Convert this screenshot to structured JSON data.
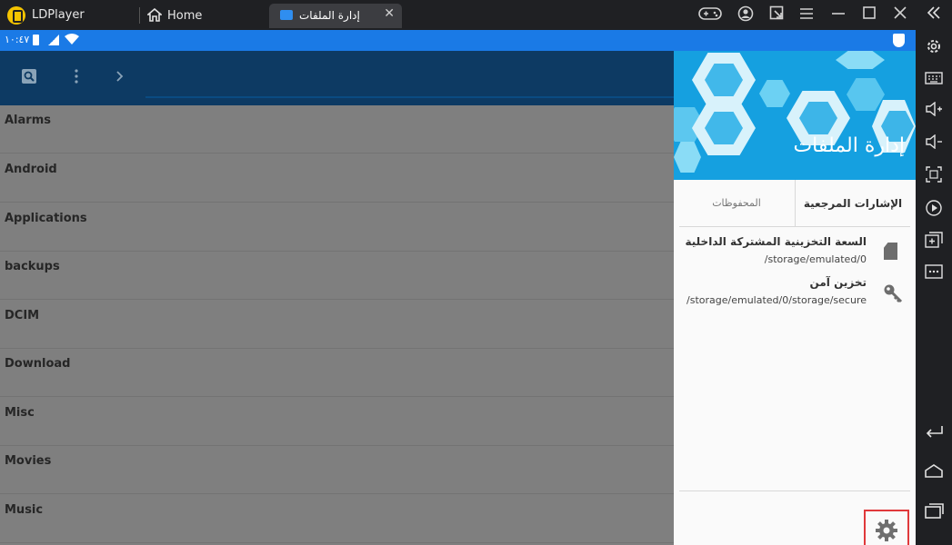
{
  "titlebar": {
    "app_name": "LDPlayer",
    "tabs": [
      {
        "label": "Home",
        "icon": "home-icon"
      },
      {
        "label": "إدارة الملفات",
        "icon": "folder-icon",
        "close": "✕"
      }
    ],
    "controls": [
      "gamepad-icon",
      "account-icon",
      "share-icon",
      "menu-icon",
      "minimize-icon",
      "maximize-icon",
      "close-icon"
    ]
  },
  "status_bar": {
    "time": "١٠:٤٧",
    "color": "#1a7ae6"
  },
  "app": {
    "toolbar_color": "#0d3a63",
    "folders": [
      "Alarms",
      "Android",
      "Applications",
      "backups",
      "DCIM",
      "Download",
      "Misc",
      "Movies",
      "Music"
    ]
  },
  "drawer": {
    "title": "إدارة الملفات",
    "header_color": "#15a0e0",
    "tabs": {
      "favorites": "المحفوظات",
      "bookmarks": "الإشارات المرجعية"
    },
    "storages": [
      {
        "name": "السعة التخزينية المشتركة الداخلية",
        "path": "/storage/emulated/0",
        "icon": "sd-card-icon"
      },
      {
        "name": "تخزين آمن",
        "path": "/storage/emulated/0/storage/secure",
        "icon": "key-icon"
      }
    ]
  },
  "sidebar": {
    "icons": [
      "collapse-icon",
      "settings-icon",
      "keyboard-icon",
      "volume-up-icon",
      "volume-down-icon",
      "screenshot-icon",
      "record-icon",
      "add-window-icon",
      "more-icon",
      "back-icon",
      "home-icon",
      "recent-apps-icon"
    ]
  }
}
